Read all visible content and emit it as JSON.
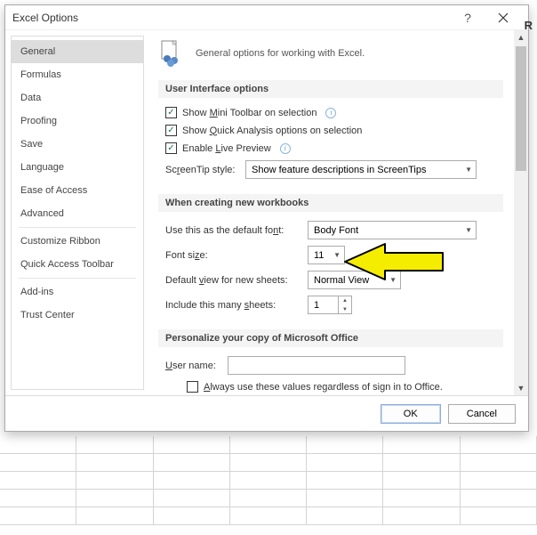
{
  "dialog": {
    "title": "Excel Options",
    "sidebar": [
      {
        "label": "General",
        "selected": true
      },
      {
        "label": "Formulas"
      },
      {
        "label": "Data"
      },
      {
        "label": "Proofing"
      },
      {
        "label": "Save"
      },
      {
        "label": "Language"
      },
      {
        "label": "Ease of Access"
      },
      {
        "label": "Advanced"
      },
      {
        "sep": true
      },
      {
        "label": "Customize Ribbon"
      },
      {
        "label": "Quick Access Toolbar"
      },
      {
        "sep": true
      },
      {
        "label": "Add-ins"
      },
      {
        "label": "Trust Center"
      }
    ],
    "header_text": "General options for working with Excel.",
    "sections": {
      "ui": {
        "title": "User Interface options",
        "mini_toolbar": "Show Mini Toolbar on selection",
        "quick_analysis": "Show Quick Analysis options on selection",
        "live_preview": "Enable Live Preview",
        "screentip_label": "ScreenTip style:",
        "screentip_value": "Show feature descriptions in ScreenTips"
      },
      "workbooks": {
        "title": "When creating new workbooks",
        "default_font_label": "Use this as the default font:",
        "default_font_value": "Body Font",
        "font_size_label": "Font size:",
        "font_size_value": "11",
        "default_view_label": "Default view for new sheets:",
        "default_view_value": "Normal View",
        "sheets_label": "Include this many sheets:",
        "sheets_value": "1"
      },
      "personalize": {
        "title": "Personalize your copy of Microsoft Office",
        "username_label": "User name:",
        "username_value": "",
        "always_use": "Always use these values regardless of sign in to Office."
      }
    },
    "buttons": {
      "ok": "OK",
      "cancel": "Cancel"
    }
  }
}
